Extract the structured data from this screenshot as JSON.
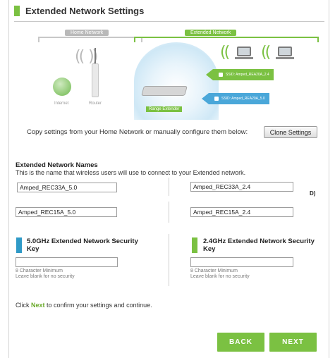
{
  "page": {
    "title": "Extended Network Settings"
  },
  "diagram": {
    "home_network_label": "Home Network",
    "extended_network_label": "Extended Network",
    "internet_label": "Internet",
    "router_label": "Router",
    "range_extender_label": "Range Extender",
    "ssid_24": "SSID: Amped_REA20A_2.4",
    "ssid_50": "SSID: Amped_REA20A_5.0"
  },
  "clone": {
    "instruction": "Copy settings from your Home Network or manually configure them below:",
    "button_label": "Clone Settings"
  },
  "extended_names": {
    "heading": "Extended Network Names",
    "description": "This is the name that wireless users will use to connect to your Extended network.",
    "ssid_50_primary": "Amped_REC33A_5.0",
    "ssid_24_primary": "Amped_REC33A_2.4",
    "ssid_50_secondary": "Amped_REC15A_5.0",
    "ssid_24_secondary": "Amped_REC15A_2.4",
    "stray_text": "D)"
  },
  "security": {
    "key_50_title": "5.0GHz Extended Network Security Key",
    "key_24_title": "2.4GHz Extended Network Security Key",
    "key_50_value": "",
    "key_24_value": "",
    "hint_line1": "8 Character Minimum",
    "hint_line2": "Leave blank for no security",
    "color_50": "#2f9ac7",
    "color_24": "#7bc142"
  },
  "footer": {
    "confirm_prefix": "Click ",
    "confirm_next": "Next",
    "confirm_suffix": " to confirm your settings and continue.",
    "back_label": "BACK",
    "next_label": "NEXT"
  },
  "theme": {
    "accent_green": "#7bc142",
    "accent_blue": "#4aa7d9"
  }
}
